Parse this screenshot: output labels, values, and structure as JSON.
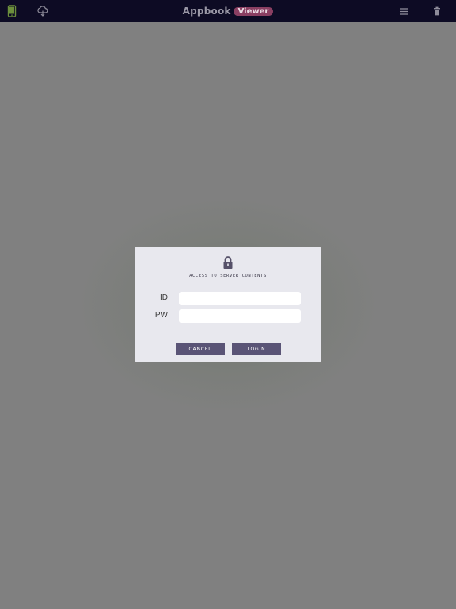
{
  "topbar": {
    "brand_name": "Appbook",
    "brand_badge": "Viewer",
    "icons": {
      "left1": "device-icon",
      "left2": "cloud-download-icon",
      "right1": "menu-icon",
      "right2": "trash-icon"
    },
    "colors": {
      "background": "#0d0b24",
      "badge": "#8a3f62",
      "device_icon": "#6c8f3c"
    }
  },
  "dialog": {
    "icon": "lock-icon",
    "title": "ACCESS TO SERVER CONTENTS",
    "id_label": "ID",
    "id_value": "",
    "pw_label": "PW",
    "pw_value": "",
    "cancel_label": "CANCEL",
    "login_label": "LOGIN",
    "colors": {
      "background": "#e8e8ee",
      "button": "#5a5476"
    }
  },
  "overlay_color": "#808080"
}
